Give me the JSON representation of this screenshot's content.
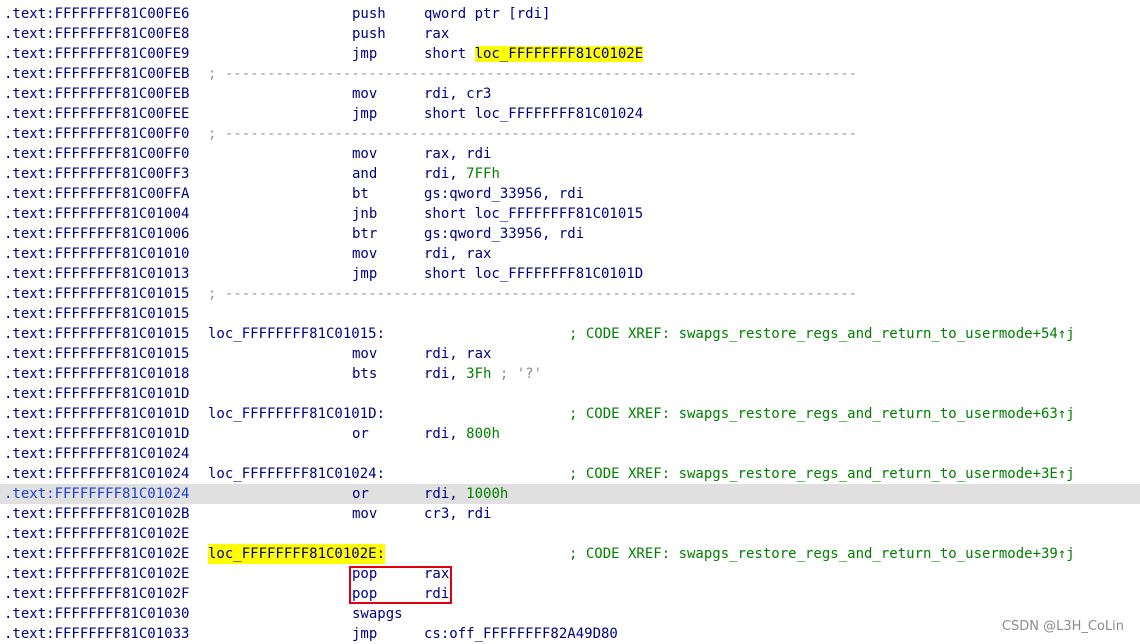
{
  "colors": {
    "address": "#000080",
    "instruction": "#000080",
    "number": "#008000",
    "xref_comment": "#008000",
    "separator": "#9a9a9a",
    "highlight": "#ffff00",
    "current_line_bg": "#e0e0e0",
    "annotation_box": "#e0000f"
  },
  "listing": [
    {
      "addr": ".text:FFFFFFFF81C00FE6",
      "type": "ins",
      "mnem": "push",
      "ops": [
        {
          "t": "qword ptr [rdi]"
        }
      ]
    },
    {
      "addr": ".text:FFFFFFFF81C00FE8",
      "type": "ins",
      "mnem": "push",
      "ops": [
        {
          "t": "rax"
        }
      ]
    },
    {
      "addr": ".text:FFFFFFFF81C00FE9",
      "type": "ins",
      "mnem": "jmp",
      "ops": [
        {
          "t": "short "
        },
        {
          "t": "loc_FFFFFFFF81C0102E",
          "c": "hl"
        }
      ]
    },
    {
      "addr": ".text:FFFFFFFF81C00FEB",
      "type": "sep",
      "text": "; ---------------------------------------------------------------------------"
    },
    {
      "addr": ".text:FFFFFFFF81C00FEB",
      "type": "ins",
      "mnem": "mov",
      "ops": [
        {
          "t": "rdi, cr3"
        }
      ]
    },
    {
      "addr": ".text:FFFFFFFF81C00FEE",
      "type": "ins",
      "mnem": "jmp",
      "ops": [
        {
          "t": "short loc_FFFFFFFF81C01024"
        }
      ]
    },
    {
      "addr": ".text:FFFFFFFF81C00FF0",
      "type": "sep",
      "text": "; ---------------------------------------------------------------------------"
    },
    {
      "addr": ".text:FFFFFFFF81C00FF0",
      "type": "ins",
      "mnem": "mov",
      "ops": [
        {
          "t": "rax, rdi"
        }
      ]
    },
    {
      "addr": ".text:FFFFFFFF81C00FF3",
      "type": "ins",
      "mnem": "and",
      "ops": [
        {
          "t": "rdi, "
        },
        {
          "t": "7FFh",
          "c": "num"
        }
      ]
    },
    {
      "addr": ".text:FFFFFFFF81C00FFA",
      "type": "ins",
      "mnem": "bt",
      "ops": [
        {
          "t": "gs:qword_33956, rdi"
        }
      ]
    },
    {
      "addr": ".text:FFFFFFFF81C01004",
      "type": "ins",
      "mnem": "jnb",
      "ops": [
        {
          "t": "short loc_FFFFFFFF81C01015"
        }
      ]
    },
    {
      "addr": ".text:FFFFFFFF81C01006",
      "type": "ins",
      "mnem": "btr",
      "ops": [
        {
          "t": "gs:qword_33956, rdi"
        }
      ]
    },
    {
      "addr": ".text:FFFFFFFF81C01010",
      "type": "ins",
      "mnem": "mov",
      "ops": [
        {
          "t": "rdi, rax"
        }
      ]
    },
    {
      "addr": ".text:FFFFFFFF81C01013",
      "type": "ins",
      "mnem": "jmp",
      "ops": [
        {
          "t": "short loc_FFFFFFFF81C0101D"
        }
      ]
    },
    {
      "addr": ".text:FFFFFFFF81C01015",
      "type": "sep",
      "text": "; ---------------------------------------------------------------------------"
    },
    {
      "addr": ".text:FFFFFFFF81C01015",
      "type": "blank"
    },
    {
      "addr": ".text:FFFFFFFF81C01015",
      "type": "label",
      "label": "loc_FFFFFFFF81C01015:",
      "xref": "; CODE XREF: swapgs_restore_regs_and_return_to_usermode+54↑j"
    },
    {
      "addr": ".text:FFFFFFFF81C01015",
      "type": "ins",
      "mnem": "mov",
      "ops": [
        {
          "t": "rdi, rax"
        }
      ]
    },
    {
      "addr": ".text:FFFFFFFF81C01018",
      "type": "ins",
      "mnem": "bts",
      "ops": [
        {
          "t": "rdi, "
        },
        {
          "t": "3Fh",
          "c": "num"
        },
        {
          "t": " ; '?'",
          "c": "cmt"
        }
      ]
    },
    {
      "addr": ".text:FFFFFFFF81C0101D",
      "type": "blank"
    },
    {
      "addr": ".text:FFFFFFFF81C0101D",
      "type": "label",
      "label": "loc_FFFFFFFF81C0101D:",
      "xref": "; CODE XREF: swapgs_restore_regs_and_return_to_usermode+63↑j"
    },
    {
      "addr": ".text:FFFFFFFF81C0101D",
      "type": "ins",
      "mnem": "or",
      "ops": [
        {
          "t": "rdi, "
        },
        {
          "t": "800h",
          "c": "num"
        }
      ]
    },
    {
      "addr": ".text:FFFFFFFF81C01024",
      "type": "blank"
    },
    {
      "addr": ".text:FFFFFFFF81C01024",
      "type": "label",
      "label": "loc_FFFFFFFF81C01024:",
      "xref": "; CODE XREF: swapgs_restore_regs_and_return_to_usermode+3E↑j"
    },
    {
      "addr": ".text:FFFFFFFF81C01024",
      "type": "ins",
      "mnem": "or",
      "ops": [
        {
          "t": "rdi, "
        },
        {
          "t": "1000h",
          "c": "num"
        }
      ],
      "current": true
    },
    {
      "addr": ".text:FFFFFFFF81C0102B",
      "type": "ins",
      "mnem": "mov",
      "ops": [
        {
          "t": "cr3, rdi"
        }
      ]
    },
    {
      "addr": ".text:FFFFFFFF81C0102E",
      "type": "blank"
    },
    {
      "addr": ".text:FFFFFFFF81C0102E",
      "type": "label",
      "label": "loc_FFFFFFFF81C0102E:",
      "label_hl": true,
      "xref": "; CODE XREF: swapgs_restore_regs_and_return_to_usermode+39↑j"
    },
    {
      "addr": ".text:FFFFFFFF81C0102E",
      "type": "ins",
      "mnem": "pop",
      "ops": [
        {
          "t": "rax"
        }
      ]
    },
    {
      "addr": ".text:FFFFFFFF81C0102F",
      "type": "ins",
      "mnem": "pop",
      "ops": [
        {
          "t": "rdi"
        }
      ]
    },
    {
      "addr": ".text:FFFFFFFF81C01030",
      "type": "ins",
      "mnem": "swapgs",
      "ops": []
    },
    {
      "addr": ".text:FFFFFFFF81C01033",
      "type": "ins",
      "mnem": "jmp",
      "ops": [
        {
          "t": "cs:off_FFFFFFFF82A49D80"
        }
      ]
    }
  ],
  "watermark": "CSDN @L3H_CoLin"
}
